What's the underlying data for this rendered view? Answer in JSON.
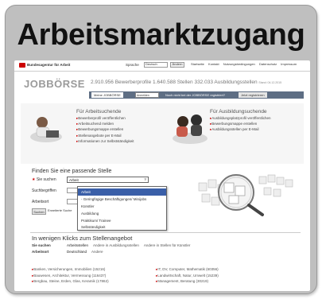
{
  "card": {
    "title": "Arbeitsmarktzugang"
  },
  "topbar": {
    "agency": "Bundesagentur für Arbeit",
    "language_label": "Sprache",
    "language_value": "Deutsch",
    "language_button": "Ändern",
    "links": [
      "Startseite",
      "Kontakt",
      "Nutzungsbedingungen",
      "Datenschutz",
      "Impressum"
    ]
  },
  "brand": {
    "name": "JOBBÖRSE",
    "stats": "2.910.956 Bewerberprofile  1.640.588 Stellen  332.033 Ausbildungsstellen",
    "stats_date": "Stand: 04.12.2015"
  },
  "loginbar": {
    "login_button": "Meine JOBBÖRSE",
    "field": "Anmelden",
    "question": "Noch nicht bei der JOBBÖRSE registriert?",
    "register": "Jetzt registrieren"
  },
  "jobseekers": {
    "title": "Für Arbeitsuchende",
    "items": [
      "Bewerberprofil veröffentlichen",
      "Arbeitsuchend melden",
      "Bewerbungsmappe erstellen",
      "Stellenangebote per E-Mail",
      "Informationen zur Selbstständigkeit"
    ]
  },
  "trainees": {
    "title": "Für Ausbildungsuchende",
    "items": [
      "Ausbildungsplatzprofil veröffentlichen",
      "Bewerbungsmappe erstellen",
      "Ausbildungsstellen per E-Mail"
    ]
  },
  "search": {
    "title": "Finden Sie eine passende Stelle",
    "label_sie_suchen": "Sie suchen",
    "selected": "Arbeit",
    "label_suchbegriffen": "Suchbegriffen",
    "label_arbeitsort": "Arbeitsort",
    "button": "Suchen",
    "extended": "Erweiterte Suche",
    "options": [
      "Arbeit",
      "- Geringfügige Beschäftigungen/ Minijobs",
      "Künstler",
      "Ausbildung",
      "Praktikum/ Trainee",
      "Selbständigkeit"
    ]
  },
  "lower": {
    "title": "In wenigen Klicks zum Stellenangebot",
    "row1_label": "Sie suchen",
    "row1_links": [
      "Arbeitsstellen",
      "Andere in Ausbildungsstellen",
      "Andere in Stellen für Künstler"
    ],
    "row2_label": "Arbeitsort",
    "row2_links": [
      "Deutschland",
      "Andere"
    ],
    "left_categories": [
      "Banken, Versicherungen, Immobilien (15216)",
      "Bauwesen, Architektur, Vermessung (116437)",
      "Bergbau, Steine, Erden, Glas, Keramik (17862)"
    ],
    "right_categories": [
      "IT, DV, Computer, Mathematik (60356)",
      "Landwirtschaft, Natur, Umwelt (15239)",
      "Management, Beratung (30219)"
    ]
  },
  "colors": {
    "card_bg": "#bfbfbf",
    "loginbar": "#5e6e84",
    "selected_option": "#3a5fa8",
    "agency_red": "#cc0000"
  }
}
